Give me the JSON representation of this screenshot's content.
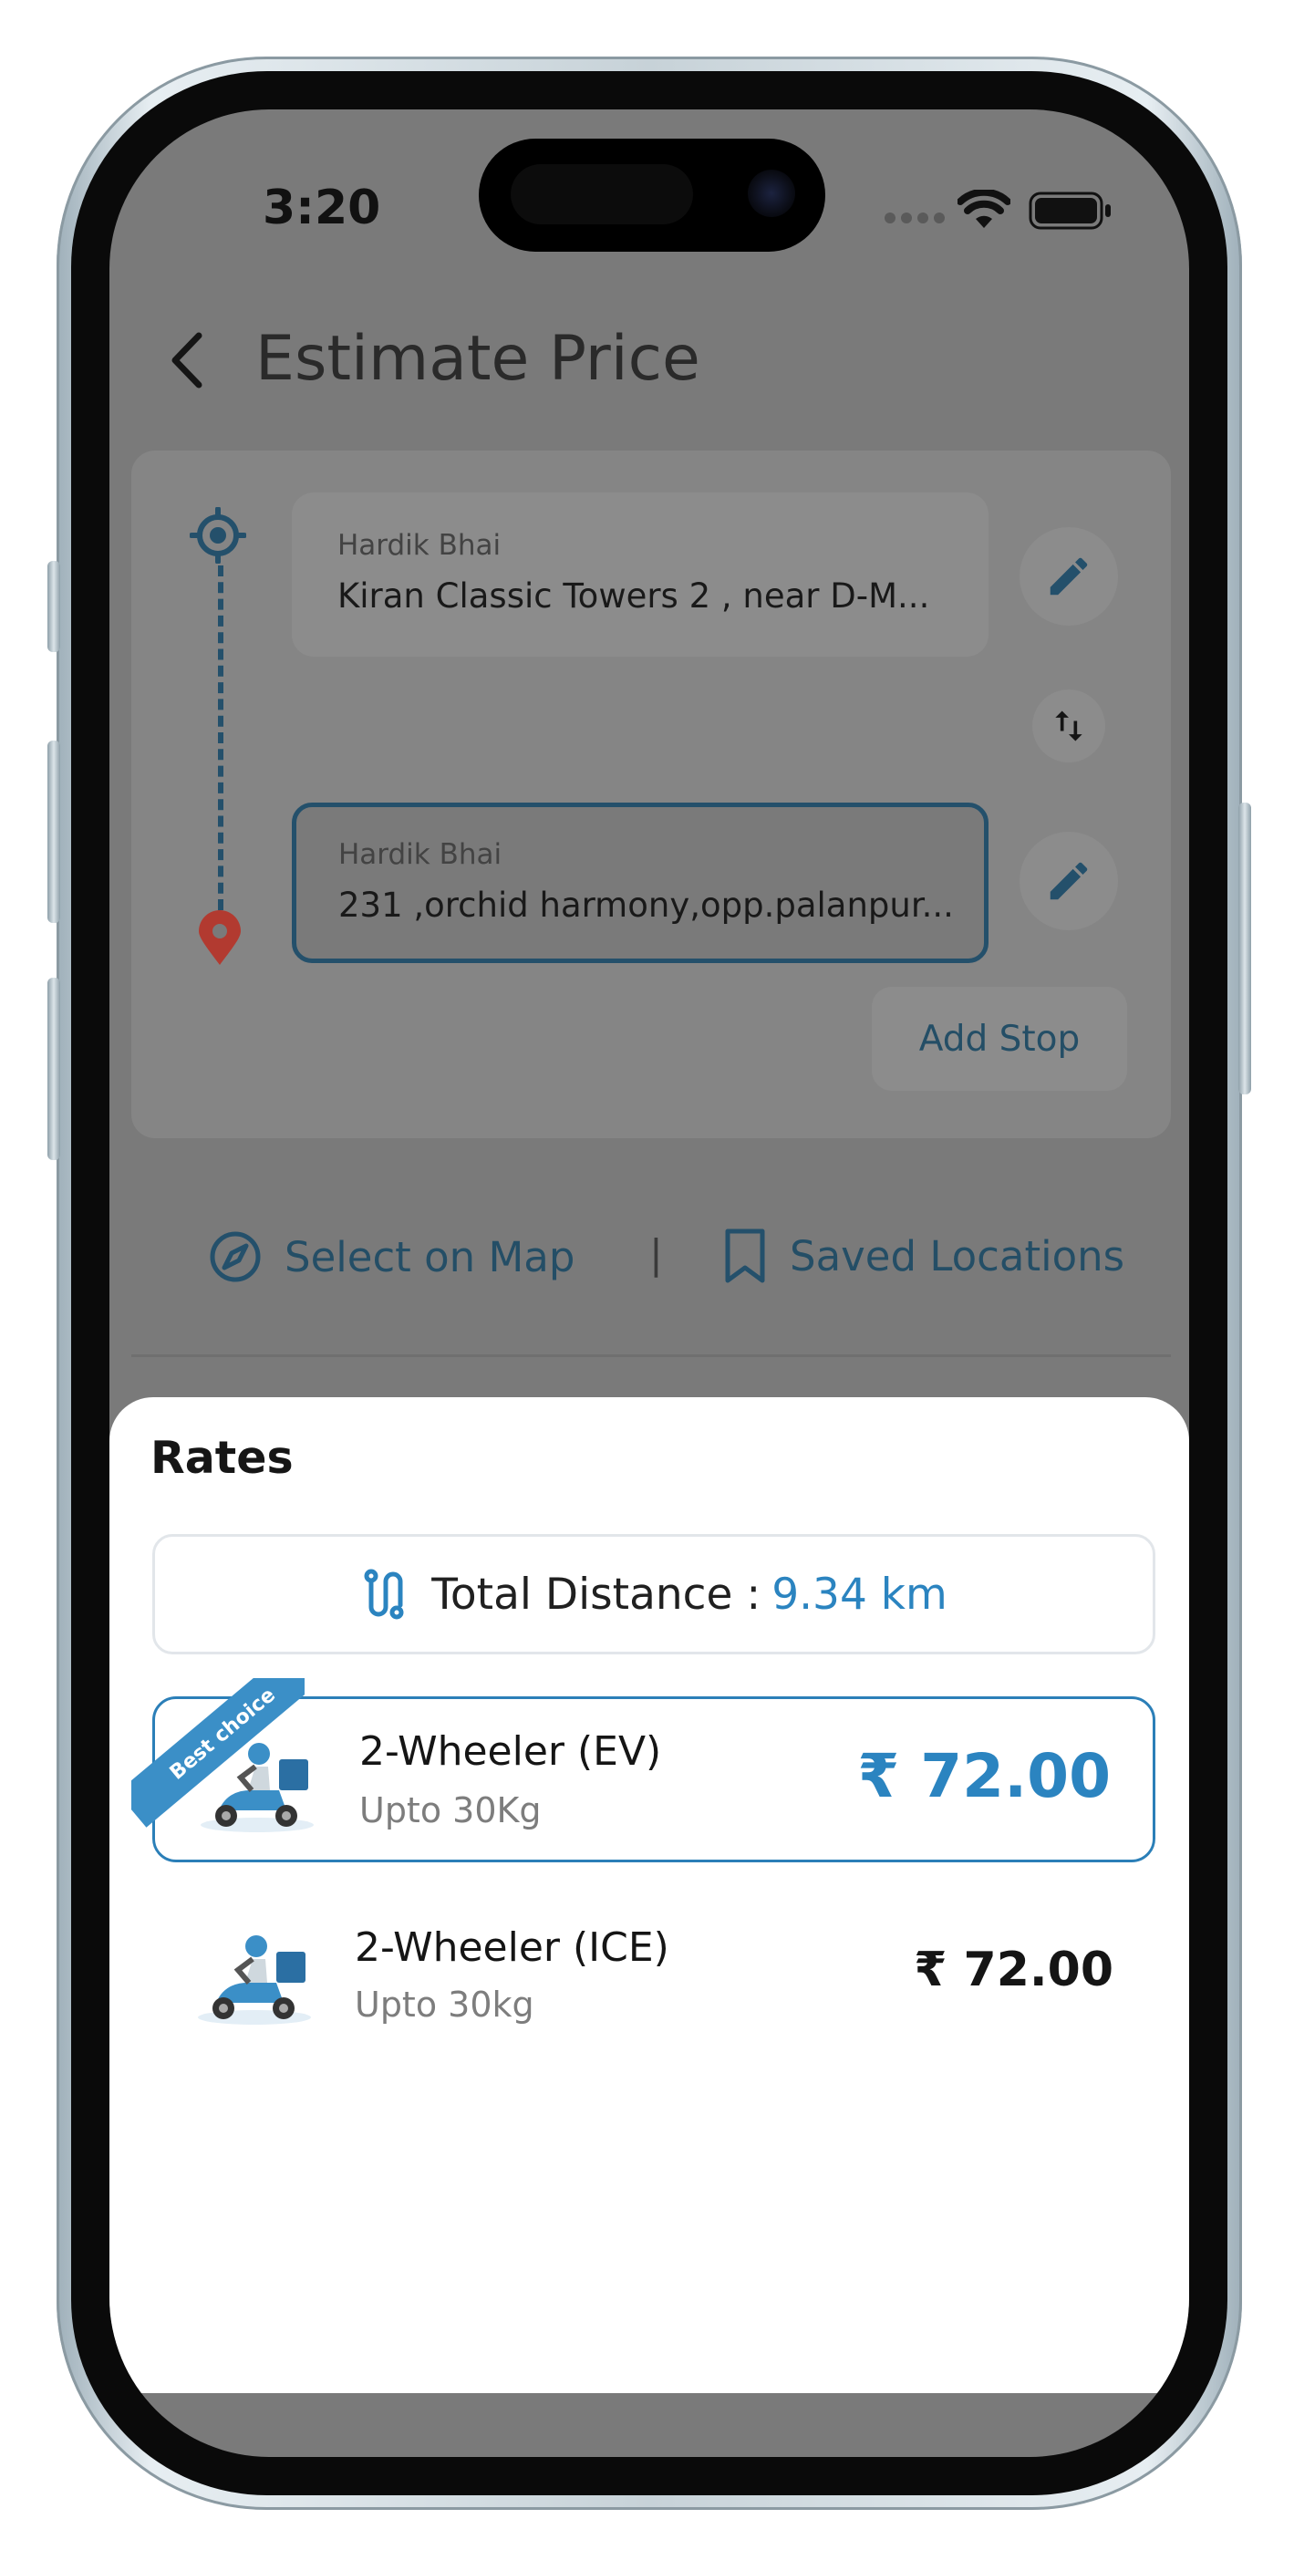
{
  "status_bar": {
    "time": "3:20"
  },
  "header": {
    "title": "Estimate Price"
  },
  "route": {
    "pickup": {
      "name": "Hardik Bhai",
      "address": "Kiran Classic Towers 2 , near D-M..."
    },
    "drop": {
      "name": "Hardik Bhai",
      "address": "231 ,orchid harmony,opp.palanpur..."
    },
    "add_stop_label": "Add Stop"
  },
  "actions": {
    "select_on_map": "Select on Map",
    "divider": "|",
    "saved_locations": "Saved Locations"
  },
  "rates_sheet": {
    "title": "Rates",
    "distance_label": "Total Distance :",
    "distance_value": "9.34 km",
    "options": [
      {
        "badge": "Best choice",
        "title": "2-Wheeler (EV)",
        "subtitle": "Upto 30Kg",
        "price": "₹ 72.00"
      },
      {
        "title": "2-Wheeler (ICE)",
        "subtitle": "Upto 30kg",
        "price": "₹ 72.00"
      }
    ]
  },
  "colors": {
    "accent": "#2B84C0",
    "dark_accent": "#24506B",
    "pin_red": "#C0392B"
  }
}
